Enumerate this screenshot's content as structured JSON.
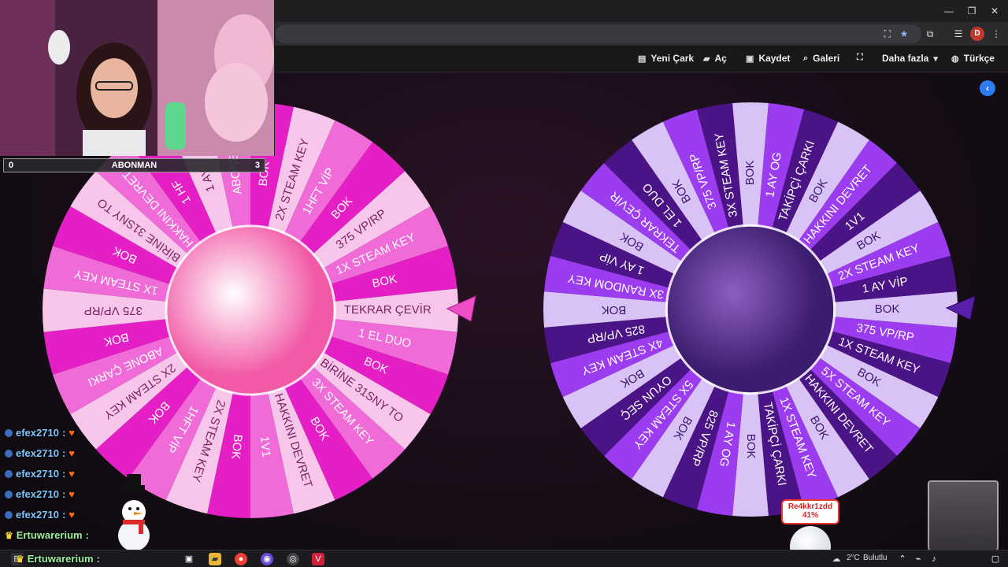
{
  "app_nav": {
    "items": [
      {
        "icon": "file-icon",
        "label": "Yeni Çark"
      },
      {
        "icon": "folder-open-icon",
        "label": "Aç"
      },
      {
        "icon": "save-icon",
        "label": "Kaydet"
      },
      {
        "icon": "search-icon",
        "label": "Galeri"
      },
      {
        "icon": "fullscreen-icon",
        "label": ""
      },
      {
        "icon": "caret-down-icon",
        "label": "Daha fazla"
      },
      {
        "icon": "globe-icon",
        "label": "Türkçe"
      }
    ]
  },
  "overlay": {
    "sub_bar": {
      "left": "0",
      "label": "ABONMAN",
      "right": "3"
    },
    "goal": {
      "name": "Re4kkr1zdd",
      "percent": "41%"
    }
  },
  "wheel_left": {
    "colors": {
      "light": "#f7c6ea",
      "mid": "#f06ad8",
      "dark": "#e51ec6",
      "center_from": "#ffffff",
      "center_to": "#f25aa6"
    },
    "segments": [
      "TEKRAR ÇEVİR",
      "1 EL DUO",
      "BOK",
      "BİRİNE 31SNY TO",
      "3X STEAM KEY",
      "BOK",
      "HAKKINI DEVRET",
      "1V1",
      "BOK",
      "2X STEAM KEY",
      "1HFT VİP",
      "BOK",
      "2X STEAM KEY",
      "ABONE ÇARKI",
      "BOK",
      "375 VP/RP",
      "1X STEAM KEY",
      "BOK",
      "BİRİNE 31SNY TO",
      "HAKKINI DEVRET",
      "1 HF",
      "1 AY",
      "ABONE",
      "BOK",
      "2X STEAM KEY",
      "1HFT VİP",
      "BOK",
      "375 VP/RP",
      "1X STEAM KEY",
      "BOK"
    ]
  },
  "wheel_right": {
    "colors": {
      "light": "#d9c2f5",
      "mid": "#9b3cf0",
      "dark": "#4a1487",
      "center_from": "#8a5fc0",
      "center_to": "#3b1c6e"
    },
    "segments": [
      "BOK",
      "375 VP/RP",
      "1X STEAM KEY",
      "BOK",
      "5X STEAM KEY",
      "HAKKINI DEVRET",
      "BOK",
      "1X STEAM KEY",
      "TAKİPÇİ ÇARKI",
      "BOK",
      "1 AY OG",
      "825 VP/RP",
      "BOK",
      "5X STEAM KEY",
      "OYUN SEÇ",
      "BOK",
      "4X STEAM KEY",
      "825 VP/RP",
      "BOK",
      "3X RANDOM KEY",
      "1 AY VİP",
      "BOK",
      "TEKRAR ÇEVİR",
      "1 EL DUO",
      "BOK",
      "375 VP/RP",
      "3X STEAM KEY",
      "BOK",
      "1 AY OG",
      "TAKİPÇİ ÇARKI",
      "BOK",
      "HAKKINI DEVRET",
      "1V1",
      "BOK",
      "2X STEAM KEY",
      "1 AY VİP"
    ]
  },
  "chat": {
    "lines": [
      {
        "user": "efex2710",
        "sep": ":",
        "msg": "♥"
      },
      {
        "user": "efex2710",
        "sep": ":",
        "msg": "♥"
      },
      {
        "user": "efex2710",
        "sep": ":",
        "msg": "♥"
      },
      {
        "user": "efex2710",
        "sep": ":",
        "msg": "♥"
      },
      {
        "user": "efex2710",
        "sep": ":",
        "msg": "♥"
      },
      {
        "user": "Ertuwarerium",
        "sep": ":",
        "msg": ""
      },
      {
        "user": "Ertuwarerium",
        "sep": ":",
        "msg": ""
      }
    ]
  },
  "taskbar": {
    "weather_temp": "2°C",
    "weather_label": "Bulutlu"
  }
}
